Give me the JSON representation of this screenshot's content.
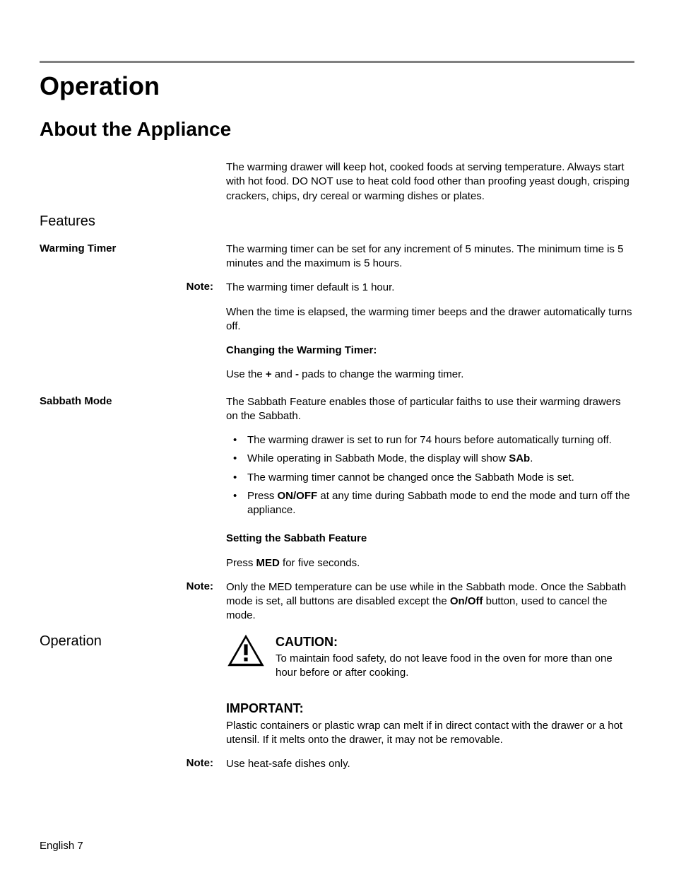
{
  "headings": {
    "h1": "Operation",
    "h2": "About the Appliance",
    "features": "Features",
    "operation_sub": "Operation"
  },
  "intro": "The warming drawer will keep hot, cooked foods at serving temperature. Always start with hot food. DO NOT use to heat cold food other than proofing yeast dough, crisping crackers, chips, dry cereal or warming dishes or plates.",
  "labels": {
    "warming_timer": "Warming Timer",
    "sabbath_mode": "Sabbath Mode",
    "note": "Note:"
  },
  "warming_timer": {
    "p1": "The warming timer can be set for any increment of 5 minutes. The minimum time is 5 minutes and the maximum is 5 hours.",
    "note1": "The warming timer default is 1 hour.",
    "p2": "When the time is elapsed, the warming timer beeps and the drawer automatically turns off.",
    "subhead": "Changing the Warming Timer:",
    "p3_pre": "Use the ",
    "p3_plus": "+",
    "p3_mid": " and ",
    "p3_minus": "-",
    "p3_post": " pads to change the warming timer."
  },
  "sabbath": {
    "p1": "The Sabbath Feature enables those of particular faiths to use their warming drawers on the Sabbath.",
    "b1": "The warming drawer is set to run for 74 hours before automatically turning off.",
    "b2_pre": "While operating in Sabbath Mode, the display will show ",
    "b2_bold": "SAb",
    "b2_post": ".",
    "b3": "The warming timer cannot be changed once the Sabbath Mode is set.",
    "b4_pre": "Press ",
    "b4_bold": "ON/OFF",
    "b4_post": " at any time during Sabbath mode to end the mode and turn off the appliance.",
    "subhead": "Setting the Sabbath Feature",
    "p2_pre": "Press ",
    "p2_bold": "MED",
    "p2_post": " for five seconds.",
    "note_pre": "Only the MED temperature can be use while in the Sabbath mode. Once the Sabbath mode is set, all buttons are disabled except the ",
    "note_bold": "On/Off",
    "note_post": " button, used to cancel the mode."
  },
  "operation_section": {
    "caution_head": "CAUTION:",
    "caution_body": "To maintain food safety, do not leave food in the oven for more than one hour before or after cooking.",
    "important_head": "IMPORTANT:",
    "important_body": "Plastic containers or plastic wrap can melt if in direct contact with the drawer or a hot utensil. If it melts onto the drawer, it may not be removable.",
    "note": "Use heat-safe dishes only."
  },
  "footer": "English 7"
}
